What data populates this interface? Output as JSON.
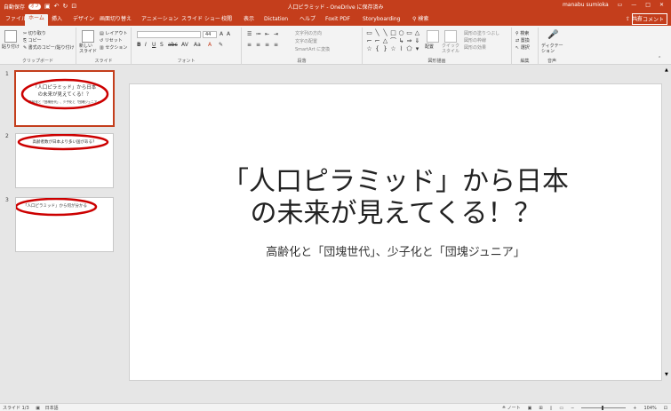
{
  "titlebar": {
    "autosave": "自動保存",
    "autosave_state": "オフ",
    "doc_title": "人口ピラミッド - OneDrive に保存済み",
    "user": "manabu sumioka"
  },
  "tabs": [
    "ファイル",
    "ホーム",
    "挿入",
    "デザイン",
    "画面切り替え",
    "アニメーション",
    "スライド ショー",
    "校閲",
    "表示",
    "Dictation",
    "ヘルプ",
    "Foxit PDF",
    "Storyboarding",
    "検索"
  ],
  "share": "共有",
  "comment": "コメント",
  "ribbon": {
    "clipboard": {
      "label": "クリップボード",
      "paste": "貼り付け",
      "cut": "切り取り",
      "copy": "コピー",
      "format_painter": "書式のコピー/貼り付け"
    },
    "slides": {
      "label": "スライド",
      "new": "新しい\nスライド",
      "layout": "レイアウト",
      "reset": "リセット",
      "section": "セクション"
    },
    "font": {
      "label": "フォント",
      "size": "44"
    },
    "paragraph": {
      "label": "段落",
      "direction": "文字列の方向",
      "align": "文字の配置",
      "smartart": "SmartArt に変換"
    },
    "drawing": {
      "label": "図形描画",
      "arrange": "配置",
      "quick": "クイック\nスタイル",
      "fill": "図形の塗りつぶし",
      "outline": "図形の枠線",
      "effects": "図形の効果"
    },
    "editing": {
      "label": "編集",
      "find": "検索",
      "replace": "置換",
      "select": "選択"
    },
    "voice": {
      "label": "音声",
      "dictation": "ディクテー\nション"
    }
  },
  "slides": [
    {
      "num": "1",
      "lines": [
        "「人口ピラミッド」から日本",
        "の未来が見えてくる！？",
        "高齢化と「団塊世代」、少子化と「団塊ジュニア」"
      ]
    },
    {
      "num": "2",
      "lines": [
        "高齢者数が日本より多い国がある？"
      ]
    },
    {
      "num": "3",
      "lines": [
        "「人口ピラミッド」から何が分かる"
      ]
    }
  ],
  "main_slide": {
    "title1": "「人口ピラミッド」から日本",
    "title2": "の未来が見えてくる！？",
    "subtitle": "高齢化と「団塊世代」、少子化と「団塊ジュニア」"
  },
  "status": {
    "slide": "スライド 1/3",
    "lang": "日本語",
    "notes": "ノート",
    "zoom": "104%"
  },
  "colors": {
    "accent": "#c43e1c",
    "annotation": "#cc0000"
  }
}
